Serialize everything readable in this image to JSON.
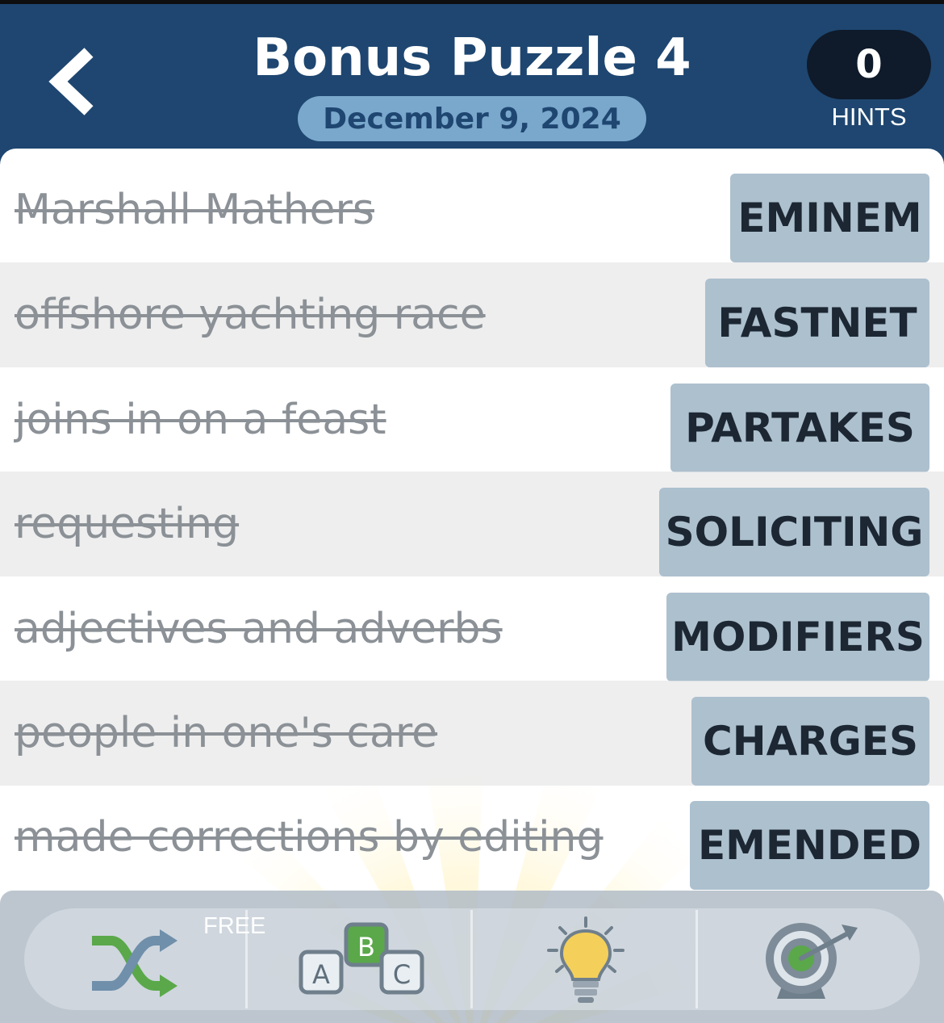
{
  "header": {
    "title": "Bonus Puzzle 4",
    "date": "December 9, 2024",
    "hints_count": "0",
    "hints_label": "HINTS"
  },
  "clues": [
    {
      "clue": "Marshall Mathers",
      "answer": "EMINEM"
    },
    {
      "clue": "offshore yachting race",
      "answer": "FASTNET"
    },
    {
      "clue": "joins in on a feast",
      "answer": "PARTAKES"
    },
    {
      "clue": "requesting",
      "answer": "SOLICITING"
    },
    {
      "clue": "adjectives and adverbs",
      "answer": "MODIFIERS"
    },
    {
      "clue": "people in one's care",
      "answer": "CHARGES"
    },
    {
      "clue": "made corrections by editing",
      "answer": "EMENDED"
    }
  ],
  "toolbar": {
    "free_label": "FREE",
    "tools": [
      {
        "icon": "shuffle-icon"
      },
      {
        "icon": "abc-blocks-icon",
        "letters": [
          "A",
          "B",
          "C"
        ]
      },
      {
        "icon": "lightbulb-icon"
      },
      {
        "icon": "target-icon"
      }
    ]
  },
  "colors": {
    "header_bg": "#1e4670",
    "date_pill": "#7aa7cc",
    "answer_tile": "#adc0ce",
    "hints_bg": "#0f1a2a"
  }
}
